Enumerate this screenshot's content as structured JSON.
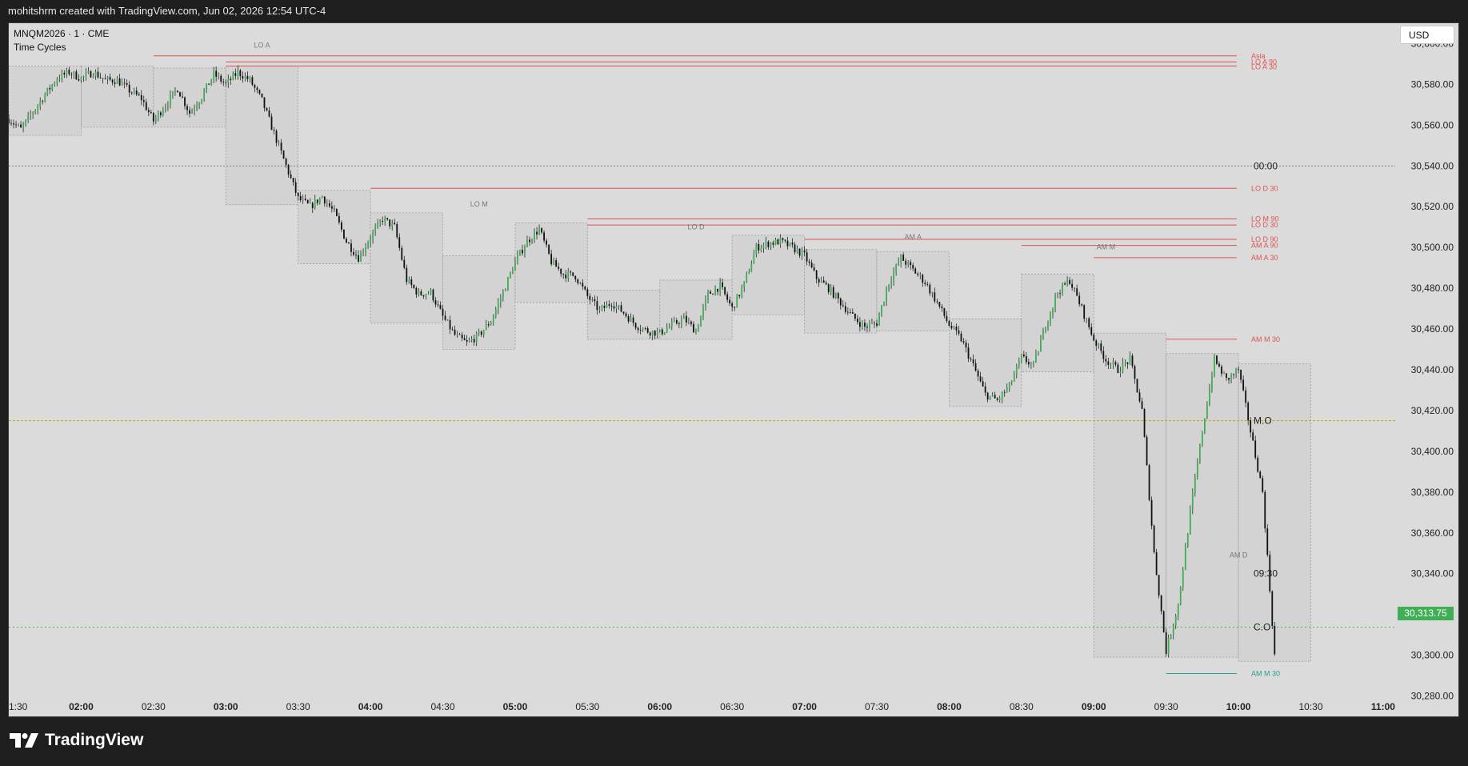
{
  "header": {
    "attribution": "mohitshrm created with TradingView.com, Jun 02, 2026 12:54 UTC-4"
  },
  "legend": {
    "symbol": "MNQM2026 · 1 · CME",
    "indicator": "Time Cycles"
  },
  "currency_button": "USD",
  "last_price": "30,313.75",
  "branding": "TradingView",
  "colors": {
    "background": "#1e1e1e",
    "chart_bg": "#dbdbdb",
    "up_candle": "#3fae54",
    "down_candle": "#111111",
    "level_line": "#e05252",
    "price_tag": "#3fae54",
    "session_line": "#c9a400"
  },
  "price_axis": {
    "labels": [
      "30,600.00",
      "30,580.00",
      "30,560.00",
      "30,540.00",
      "30,520.00",
      "30,500.00",
      "30,480.00",
      "30,460.00",
      "30,440.00",
      "30,420.00",
      "30,400.00",
      "30,380.00",
      "30,360.00",
      "30,340.00",
      "30,320.00",
      "30,300.00",
      "30,280.00"
    ]
  },
  "time_axis": {
    "labels": [
      {
        "text": "1:30",
        "bold": false
      },
      {
        "text": "02:00",
        "bold": true
      },
      {
        "text": "02:30",
        "bold": false
      },
      {
        "text": "03:00",
        "bold": true
      },
      {
        "text": "03:30",
        "bold": false
      },
      {
        "text": "04:00",
        "bold": true
      },
      {
        "text": "04:30",
        "bold": false
      },
      {
        "text": "05:00",
        "bold": true
      },
      {
        "text": "05:30",
        "bold": false
      },
      {
        "text": "06:00",
        "bold": true
      },
      {
        "text": "06:30",
        "bold": false
      },
      {
        "text": "07:00",
        "bold": true
      },
      {
        "text": "07:30",
        "bold": false
      },
      {
        "text": "08:00",
        "bold": true
      },
      {
        "text": "08:30",
        "bold": false
      },
      {
        "text": "09:00",
        "bold": true
      },
      {
        "text": "09:30",
        "bold": false
      },
      {
        "text": "10:00",
        "bold": true
      },
      {
        "text": "10:30",
        "bold": false
      },
      {
        "text": "11:00",
        "bold": true
      }
    ]
  },
  "chart_data": {
    "type": "candlestick",
    "symbol": "MNQM2026",
    "interval": "1",
    "ylim": [
      30270,
      30610
    ],
    "x_range": [
      "01:30",
      "11:05"
    ],
    "price_path": [
      [
        "01:30",
        30563
      ],
      [
        "01:35",
        30558
      ],
      [
        "01:45",
        30575
      ],
      [
        "01:50",
        30583
      ],
      [
        "01:55",
        30586
      ],
      [
        "02:00",
        30583
      ],
      [
        "02:05",
        30586
      ],
      [
        "02:10",
        30582
      ],
      [
        "02:15",
        30582
      ],
      [
        "02:20",
        30577
      ],
      [
        "02:25",
        30573
      ],
      [
        "02:30",
        30562
      ],
      [
        "02:35",
        30570
      ],
      [
        "02:40",
        30578
      ],
      [
        "02:45",
        30566
      ],
      [
        "02:50",
        30574
      ],
      [
        "02:55",
        30585
      ],
      [
        "03:00",
        30580
      ],
      [
        "03:05",
        30586
      ],
      [
        "03:10",
        30582
      ],
      [
        "03:15",
        30572
      ],
      [
        "03:20",
        30556
      ],
      [
        "03:25",
        30540
      ],
      [
        "03:30",
        30524
      ],
      [
        "03:35",
        30520
      ],
      [
        "03:40",
        30525
      ],
      [
        "03:45",
        30517
      ],
      [
        "03:50",
        30503
      ],
      [
        "03:55",
        30495
      ],
      [
        "04:00",
        30505
      ],
      [
        "04:05",
        30514
      ],
      [
        "04:10",
        30510
      ],
      [
        "04:15",
        30484
      ],
      [
        "04:20",
        30477
      ],
      [
        "04:25",
        30478
      ],
      [
        "04:30",
        30466
      ],
      [
        "04:35",
        30457
      ],
      [
        "04:40",
        30453
      ],
      [
        "04:45",
        30457
      ],
      [
        "04:50",
        30464
      ],
      [
        "04:55",
        30478
      ],
      [
        "05:00",
        30493
      ],
      [
        "05:05",
        30503
      ],
      [
        "05:10",
        30509
      ],
      [
        "05:15",
        30493
      ],
      [
        "05:20",
        30487
      ],
      [
        "05:25",
        30486
      ],
      [
        "05:30",
        30476
      ],
      [
        "05:35",
        30469
      ],
      [
        "05:40",
        30473
      ],
      [
        "05:45",
        30468
      ],
      [
        "05:50",
        30462
      ],
      [
        "05:55",
        30459
      ],
      [
        "06:00",
        30458
      ],
      [
        "06:05",
        30462
      ],
      [
        "06:10",
        30465
      ],
      [
        "06:15",
        30459
      ],
      [
        "06:20",
        30477
      ],
      [
        "06:25",
        30481
      ],
      [
        "06:30",
        30470
      ],
      [
        "06:35",
        30482
      ],
      [
        "06:40",
        30500
      ],
      [
        "06:45",
        30502
      ],
      [
        "06:50",
        30503
      ],
      [
        "06:55",
        30500
      ],
      [
        "07:00",
        30496
      ],
      [
        "07:05",
        30485
      ],
      [
        "07:10",
        30480
      ],
      [
        "07:15",
        30473
      ],
      [
        "07:20",
        30466
      ],
      [
        "07:25",
        30461
      ],
      [
        "07:30",
        30463
      ],
      [
        "07:35",
        30483
      ],
      [
        "07:40",
        30495
      ],
      [
        "07:45",
        30489
      ],
      [
        "07:50",
        30483
      ],
      [
        "07:55",
        30473
      ],
      [
        "08:00",
        30462
      ],
      [
        "08:05",
        30455
      ],
      [
        "08:10",
        30442
      ],
      [
        "08:15",
        30428
      ],
      [
        "08:20",
        30425
      ],
      [
        "08:25",
        30432
      ],
      [
        "08:30",
        30446
      ],
      [
        "08:35",
        30442
      ],
      [
        "08:40",
        30462
      ],
      [
        "08:45",
        30478
      ],
      [
        "08:50",
        30484
      ],
      [
        "08:55",
        30470
      ],
      [
        "09:00",
        30455
      ],
      [
        "09:05",
        30445
      ],
      [
        "09:10",
        30440
      ],
      [
        "09:15",
        30445
      ],
      [
        "09:20",
        30420
      ],
      [
        "09:25",
        30350
      ],
      [
        "09:30",
        30302
      ],
      [
        "09:35",
        30325
      ],
      [
        "09:40",
        30370
      ],
      [
        "09:45",
        30410
      ],
      [
        "09:50",
        30445
      ],
      [
        "09:55",
        30435
      ],
      [
        "10:00",
        30440
      ],
      [
        "10:05",
        30410
      ],
      [
        "10:10",
        30380
      ],
      [
        "10:15",
        30300
      ]
    ],
    "levels": [
      {
        "label": "Asia",
        "price": 30594,
        "start": "02:30"
      },
      {
        "label": "LO A 90",
        "price": 30591,
        "start": "03:00"
      },
      {
        "label": "LO A 30",
        "price": 30589,
        "start": "03:00"
      },
      {
        "label": "LO D 30",
        "price": 30529,
        "start": "04:00"
      },
      {
        "label": "LO M 90",
        "price": 30514,
        "start": "05:30"
      },
      {
        "label": "LO D 30",
        "price": 30511,
        "start": "05:30"
      },
      {
        "label": "LO D 90",
        "price": 30504,
        "start": "07:00"
      },
      {
        "label": "AM A 90",
        "price": 30501,
        "start": "08:30"
      },
      {
        "label": "AM A 30",
        "price": 30495,
        "start": "09:00"
      },
      {
        "label": "AM M 30",
        "price": 30455,
        "start": "09:30"
      },
      {
        "label": "AM M 30",
        "price": 30291,
        "start": "09:30",
        "teal": true
      }
    ],
    "right_labels": [
      {
        "text": "00:00",
        "price": 30540
      },
      {
        "text": "M.O",
        "price": 30415
      },
      {
        "text": "09:30",
        "price": 30340
      },
      {
        "text": "C.O",
        "price": 30313.75
      }
    ],
    "box_labels": [
      {
        "text": "LO A",
        "time": "03:15",
        "price": 30598
      },
      {
        "text": "LO M",
        "time": "04:45",
        "price": 30520
      },
      {
        "text": "LO D",
        "time": "06:15",
        "price": 30509
      },
      {
        "text": "AM A",
        "time": "07:45",
        "price": 30504
      },
      {
        "text": "AM M",
        "time": "09:05",
        "price": 30499
      },
      {
        "text": "AM D",
        "time": "10:00",
        "price": 30348
      }
    ]
  }
}
